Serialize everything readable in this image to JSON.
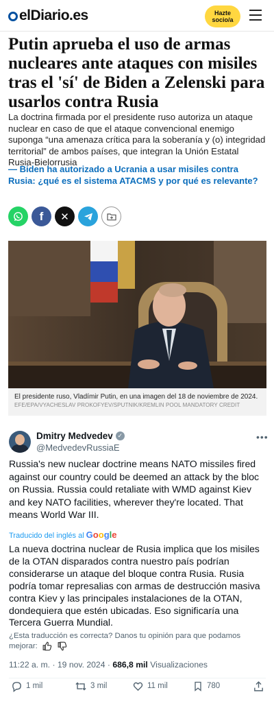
{
  "header": {
    "logo_text": "elDiario.es",
    "subscribe_label": "Hazte socio/a"
  },
  "article": {
    "headline": "Putin aprueba el uso de armas nucleares ante ataques con misiles tras el 'sí' de Biden a Zelenski para usarlos contra Rusia",
    "lead": "La doctrina firmada por el presidente ruso autoriza un ataque nuclear en caso de que el ataque convencional enemigo suponga “una amenaza crítica para la soberanía y (o) integridad territorial” de ambos países, que integran la Unión Estatal Rusia-Bielorrusia",
    "related": "— Biden ha autorizado a Ucrania a usar misiles contra Rusia: ¿qué es el sistema ATACMS y por qué es relevante?",
    "share_buttons": [
      "whatsapp-icon",
      "facebook-icon",
      "x-icon",
      "telegram-icon",
      "save-icon"
    ],
    "photo_caption": "El presidente ruso, Vladímir Putin, en una imagen del 18 de noviembre de 2024.",
    "photo_credit": "EFE/EPA/VYACHESLAV PROKOFYEV/SPUTNIK/KREMLIN POOL MANDATORY CREDIT"
  },
  "tweet": {
    "name": "Dmitry Medvedev",
    "handle": "@MedvedevRussiaE",
    "text": "Russia's new nuclear doctrine means NATO missiles fired against our country could be deemed an attack by the bloc on Russia. Russia could retaliate with WMD against Kiev and key NATO facilities, wherever they're located. That means World War III.",
    "translated_label": "Traducido del inglés al",
    "google_letters": [
      "G",
      "o",
      "o",
      "g",
      "l",
      "e"
    ],
    "translation": "La nueva doctrina nuclear de Rusia implica que los misiles de la OTAN disparados contra nuestro país podrían considerarse un ataque del bloque contra Rusia. Rusia podría tomar represalias con armas de destrucción masiva contra Kiev y las principales instalaciones de la OTAN, dondequiera que estén ubicadas. Eso significaría una Tercera Guerra Mundial.",
    "feedback": "¿Esta traducción es correcta? Danos tu opinión para que podamos mejorar:",
    "time": "11:22 a. m. · 19 nov. 2024 ·",
    "views": "686,8 mil",
    "views_label": "Visualizaciones",
    "replies": "1 mil",
    "retweets": "3 mil",
    "likes": "11 mil",
    "bookmarks": "780"
  },
  "colors": {
    "brand_blue": "#0050a0",
    "subscribe_yellow": "#ffd740",
    "link_blue": "#0c6ebc",
    "twitter_blue": "#1d9bf0"
  }
}
